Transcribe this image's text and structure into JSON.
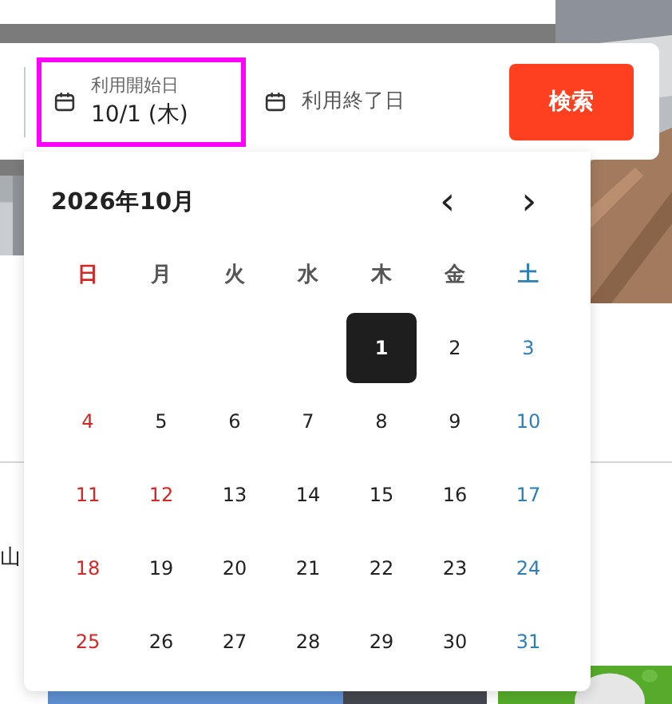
{
  "search_bar": {
    "start_field": {
      "label": "利用開始日",
      "value": "10/1 (木)",
      "selected": true
    },
    "end_field": {
      "placeholder": "利用終了日"
    },
    "search_button": "検索"
  },
  "calendar": {
    "title": "2026年10月",
    "prev": "‹",
    "next": "›",
    "weekdays": [
      {
        "label": "日",
        "kind": "holiday"
      },
      {
        "label": "月",
        "kind": "weekday"
      },
      {
        "label": "火",
        "kind": "weekday"
      },
      {
        "label": "水",
        "kind": "weekday"
      },
      {
        "label": "木",
        "kind": "weekday"
      },
      {
        "label": "金",
        "kind": "weekday"
      },
      {
        "label": "土",
        "kind": "saturday"
      }
    ],
    "weeks": [
      [
        {
          "label": "1",
          "kind": "weekday",
          "selected": true
        },
        {
          "label": "2",
          "kind": "weekday",
          "selected": false
        },
        {
          "label": "3",
          "kind": "saturday",
          "selected": false
        }
      ],
      [
        {
          "label": "4",
          "kind": "holiday",
          "selected": false
        },
        {
          "label": "5",
          "kind": "weekday",
          "selected": false
        },
        {
          "label": "6",
          "kind": "weekday",
          "selected": false
        },
        {
          "label": "7",
          "kind": "weekday",
          "selected": false
        },
        {
          "label": "8",
          "kind": "weekday",
          "selected": false
        },
        {
          "label": "9",
          "kind": "weekday",
          "selected": false
        },
        {
          "label": "10",
          "kind": "saturday",
          "selected": false
        }
      ],
      [
        {
          "label": "11",
          "kind": "holiday",
          "selected": false
        },
        {
          "label": "12",
          "kind": "holiday",
          "selected": false
        },
        {
          "label": "13",
          "kind": "weekday",
          "selected": false
        },
        {
          "label": "14",
          "kind": "weekday",
          "selected": false
        },
        {
          "label": "15",
          "kind": "weekday",
          "selected": false
        },
        {
          "label": "16",
          "kind": "weekday",
          "selected": false
        },
        {
          "label": "17",
          "kind": "saturday",
          "selected": false
        }
      ],
      [
        {
          "label": "18",
          "kind": "holiday",
          "selected": false
        },
        {
          "label": "19",
          "kind": "weekday",
          "selected": false
        },
        {
          "label": "20",
          "kind": "weekday",
          "selected": false
        },
        {
          "label": "21",
          "kind": "weekday",
          "selected": false
        },
        {
          "label": "22",
          "kind": "weekday",
          "selected": false
        },
        {
          "label": "23",
          "kind": "weekday",
          "selected": false
        },
        {
          "label": "24",
          "kind": "saturday",
          "selected": false
        }
      ],
      [
        {
          "label": "25",
          "kind": "holiday",
          "selected": false
        },
        {
          "label": "26",
          "kind": "weekday",
          "selected": false
        },
        {
          "label": "27",
          "kind": "weekday",
          "selected": false
        },
        {
          "label": "28",
          "kind": "weekday",
          "selected": false
        },
        {
          "label": "29",
          "kind": "weekday",
          "selected": false
        },
        {
          "label": "30",
          "kind": "weekday",
          "selected": false
        },
        {
          "label": "31",
          "kind": "saturday",
          "selected": false
        }
      ]
    ]
  },
  "background": {
    "partial_text": "山"
  }
}
